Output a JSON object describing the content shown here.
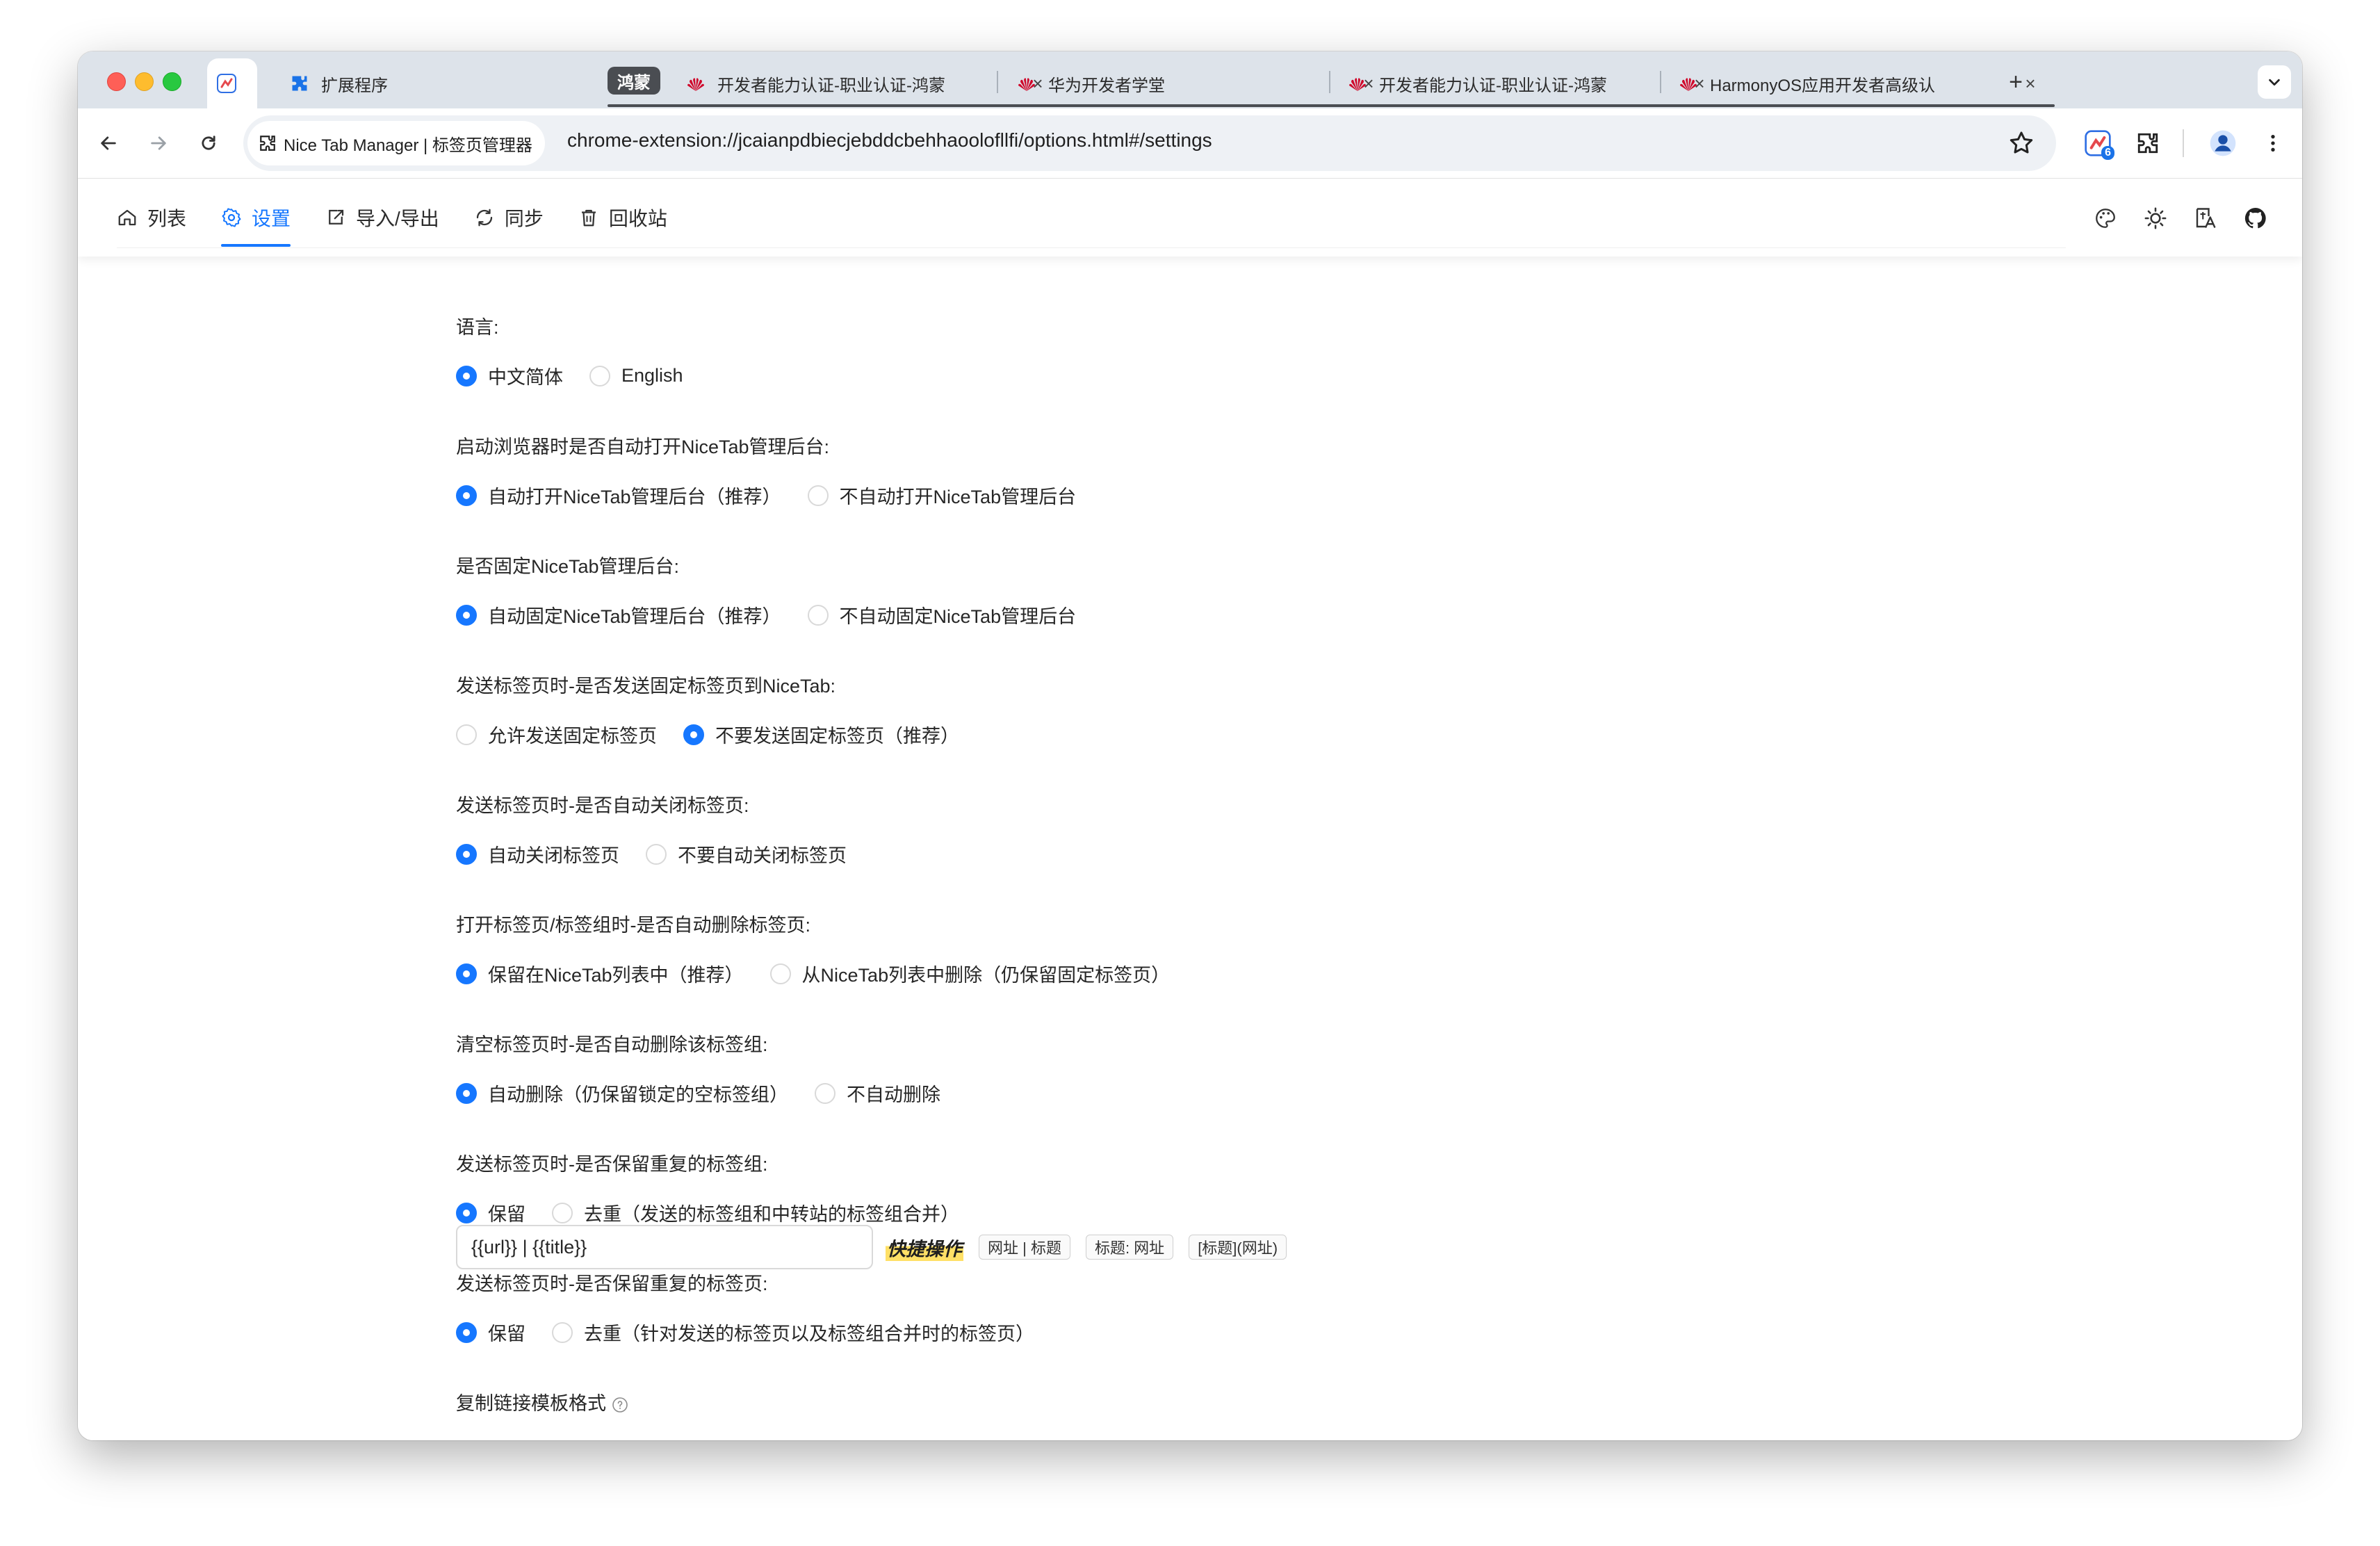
{
  "browser": {
    "tabs": [
      {
        "title": "扩展程序",
        "favicon": "puzzle-icon"
      },
      {
        "title": "开发者能力认证-职业认证-鸿蒙",
        "favicon": "huawei-icon"
      },
      {
        "title": "华为开发者学堂",
        "favicon": "huawei-icon"
      },
      {
        "title": "开发者能力认证-职业认证-鸿蒙",
        "favicon": "huawei-icon"
      },
      {
        "title": "HarmonyOS应用开发者高级认",
        "favicon": "huawei-icon"
      }
    ],
    "tab_group_label": "鸿蒙",
    "site_chip": "Nice Tab Manager | 标签页管理器",
    "url": "chrome-extension://jcaianpdbiecjebddcbehhaoolofllfi/options.html#/settings",
    "extension_badge": "6",
    "group_color": "#4a4d52"
  },
  "nav": {
    "items": [
      {
        "label": "列表",
        "icon": "home-icon"
      },
      {
        "label": "设置",
        "icon": "settings-icon"
      },
      {
        "label": "导入/导出",
        "icon": "import-export-icon"
      },
      {
        "label": "同步",
        "icon": "sync-icon"
      },
      {
        "label": "回收站",
        "icon": "trash-icon"
      }
    ],
    "active": "设置",
    "accent_color": "#1677ff"
  },
  "settings": [
    {
      "label": "语言:",
      "options": [
        {
          "text": "中文简体",
          "checked": true
        },
        {
          "text": "English",
          "checked": false
        }
      ]
    },
    {
      "label": "启动浏览器时是否自动打开NiceTab管理后台:",
      "options": [
        {
          "text": "自动打开NiceTab管理后台（推荐）",
          "checked": true
        },
        {
          "text": "不自动打开NiceTab管理后台",
          "checked": false
        }
      ]
    },
    {
      "label": "是否固定NiceTab管理后台:",
      "options": [
        {
          "text": "自动固定NiceTab管理后台（推荐）",
          "checked": true
        },
        {
          "text": "不自动固定NiceTab管理后台",
          "checked": false
        }
      ]
    },
    {
      "label": "发送标签页时-是否发送固定标签页到NiceTab:",
      "options": [
        {
          "text": "允许发送固定标签页",
          "checked": false
        },
        {
          "text": "不要发送固定标签页（推荐）",
          "checked": true
        }
      ]
    },
    {
      "label": "发送标签页时-是否自动关闭标签页:",
      "options": [
        {
          "text": "自动关闭标签页",
          "checked": true
        },
        {
          "text": "不要自动关闭标签页",
          "checked": false
        }
      ]
    },
    {
      "label": "打开标签页/标签组时-是否自动删除标签页:",
      "options": [
        {
          "text": "保留在NiceTab列表中（推荐）",
          "checked": true
        },
        {
          "text": "从NiceTab列表中删除（仍保留固定标签页）",
          "checked": false
        }
      ]
    },
    {
      "label": "清空标签页时-是否自动删除该标签组:",
      "options": [
        {
          "text": "自动删除（仍保留锁定的空标签组）",
          "checked": true
        },
        {
          "text": "不自动删除",
          "checked": false
        }
      ]
    },
    {
      "label": "发送标签页时-是否保留重复的标签组:",
      "options": [
        {
          "text": "保留",
          "checked": true
        },
        {
          "text": "去重（发送的标签组和中转站的标签组合并）",
          "checked": false
        }
      ]
    },
    {
      "label": "发送标签页时-是否保留重复的标签页:",
      "options": [
        {
          "text": "保留",
          "checked": true
        },
        {
          "text": "去重（针对发送的标签页以及标签组合并时的标签页）",
          "checked": false
        }
      ]
    }
  ],
  "copy_template": {
    "label": "复制链接模板格式",
    "value": "{{url}} | {{title}}",
    "quick_label": "快捷操作",
    "quick_buttons": [
      "网址 | 标题",
      "标题: 网址",
      "[标题](网址)"
    ]
  }
}
